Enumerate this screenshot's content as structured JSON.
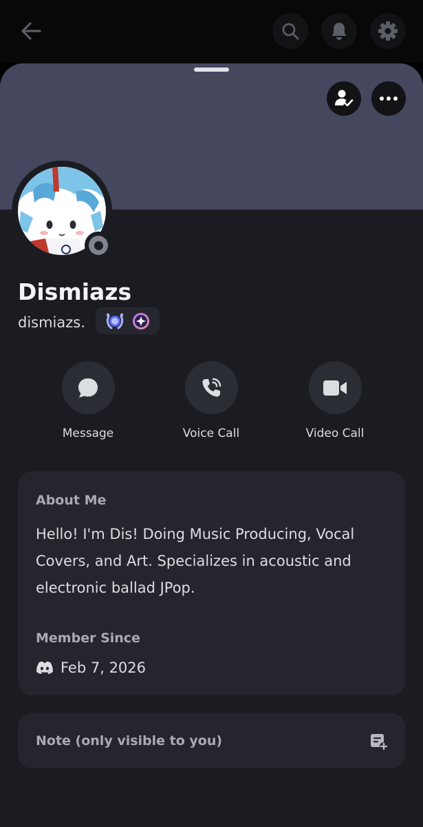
{
  "profile": {
    "display_name": "Dismiazs",
    "username": "dismiazs.",
    "status": "offline"
  },
  "actions": [
    {
      "label": "Message",
      "icon": "chat-bubble-icon"
    },
    {
      "label": "Voice Call",
      "icon": "phone-icon"
    },
    {
      "label": "Video Call",
      "icon": "video-camera-icon"
    }
  ],
  "about": {
    "title": "About Me",
    "text": "Hello! I'm Dis! Doing Music Producing, Vocal Covers, and Art. Specializes in acoustic and electronic ballad JPop."
  },
  "member_since": {
    "title": "Member Since",
    "date": "Feb 7, 2026"
  },
  "note": {
    "placeholder": "Note (only visible to you)"
  },
  "colors": {
    "banner": "#45475f",
    "background": "#1b1c21",
    "card": "#25262d"
  }
}
